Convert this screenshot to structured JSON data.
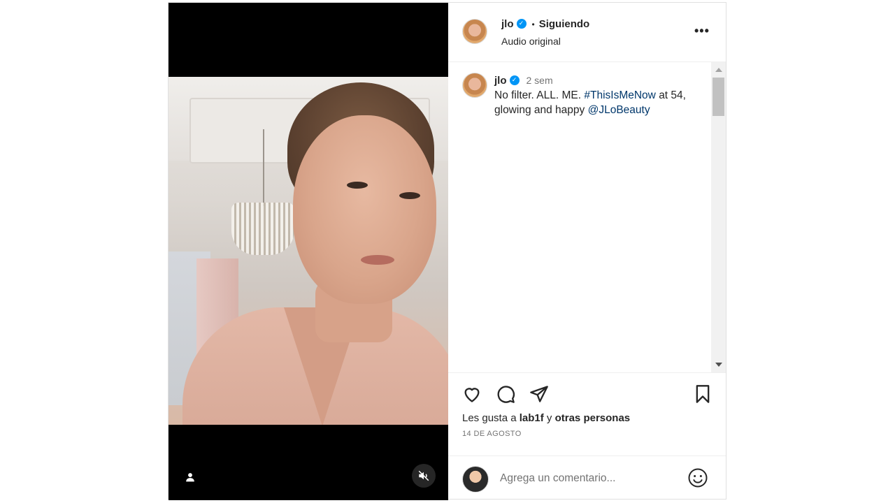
{
  "post": {
    "username": "jlo",
    "follow_status": "Siguiendo",
    "audio": "Audio original",
    "caption_username": "jlo",
    "caption_time": "2 sem",
    "caption_text_1": "No filter. ALL. ME.",
    "caption_hashtag": "#ThisIsMeNow",
    "caption_text_2": "at 54, glowing and happy",
    "caption_mention": "@JLoBeauty",
    "likes_prefix": "Les gusta a",
    "likes_user": "lab1f",
    "likes_conj": "y",
    "likes_others": "otras personas",
    "date": "14 DE AGOSTO",
    "comment_placeholder": "Agrega un comentario..."
  },
  "colors": {
    "link": "#00376b",
    "verified": "#0095f6",
    "muted_text": "#737373"
  },
  "icons": {
    "more": "more-options-icon",
    "like": "heart-icon",
    "comment": "comment-icon",
    "share": "paper-plane-icon",
    "save": "bookmark-icon",
    "emoji": "emoji-icon",
    "mute": "speaker-muted-icon",
    "tags": "user-tag-icon"
  }
}
